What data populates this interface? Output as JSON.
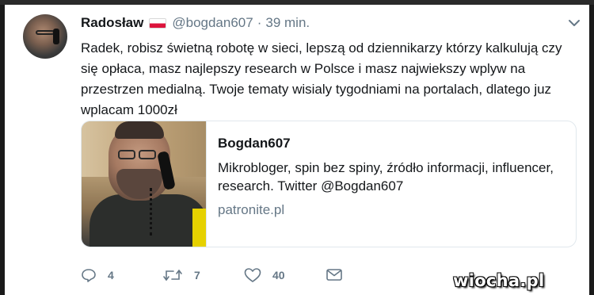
{
  "tweet": {
    "author": {
      "name": "Radosław",
      "flag": "poland-flag",
      "handle": "@bogdan607",
      "separator": "·",
      "time": "39 min."
    },
    "text": "Radek, robisz świetną robotę w sieci, lepszą od dziennikarzy którzy kalkulują czy się opłaca, masz najlepszy research w Polsce i masz najwiekszy wplyw na przestrzen medialną. Twoje tematy wisialy tygodniami na portalach, dlatego juz wplacam 1000zł",
    "card": {
      "title": "Bogdan607",
      "description": "Mikrobloger, spin bez spiny, źródło informacji, influencer, research. Twitter @Bogdan607",
      "domain": "patronite.pl"
    },
    "actions": {
      "replies": "4",
      "retweets": "7",
      "likes": "40"
    }
  },
  "watermark": "wiocha.pl",
  "colors": {
    "text": "#14171a",
    "muted": "#657786",
    "border": "#e1e8ed",
    "flag_white": "#ffffff",
    "flag_red": "#dc143c"
  },
  "icons": [
    "chevron-down-icon",
    "reply-icon",
    "retweet-icon",
    "like-icon",
    "direct-message-icon"
  ]
}
